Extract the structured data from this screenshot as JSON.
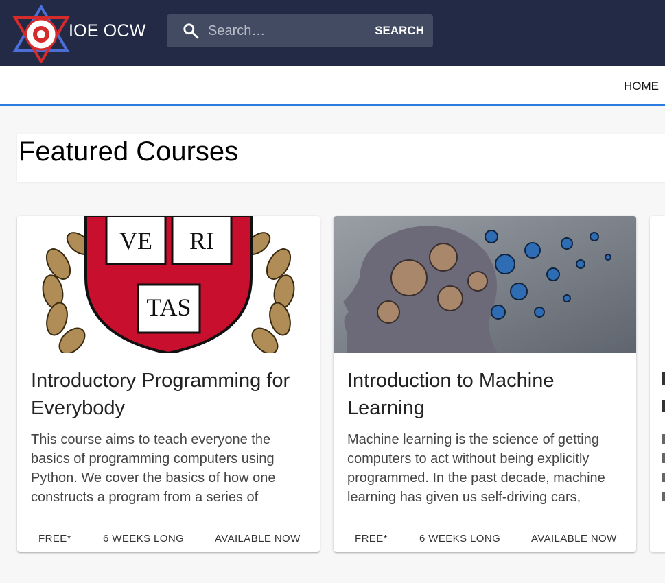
{
  "header": {
    "brand": "IOE OCW",
    "search_placeholder": "Search…",
    "search_button": "SEARCH"
  },
  "nav": {
    "home": "HOME"
  },
  "section": {
    "title": "Featured Courses"
  },
  "courses": [
    {
      "title": "Introductory Programming for Everybody",
      "description": "This course aims to teach everyone the basics of programming computers using Python. We cover the basics of how one constructs a program from a series of",
      "meta": [
        "FREE*",
        "6 WEEKS LONG",
        "AVAILABLE NOW"
      ],
      "image": "harvard-crest-veritas-image"
    },
    {
      "title": "Introduction to Machine Learning",
      "description": "Machine learning is the science of getting computers to act without being explicitly programmed. In the past decade, machine learning has given us self-driving cars,",
      "meta": [
        "FREE*",
        "6 WEEKS LONG",
        "AVAILABLE NOW"
      ],
      "image": "head-with-gears-image"
    }
  ],
  "crest": {
    "words": [
      "VE",
      "RI",
      "TAS"
    ]
  },
  "colors": {
    "header_bg": "#222a45",
    "search_bg": "#434b62",
    "nav_underline": "#2c7be0",
    "crest_red": "#c8102e",
    "laurel_gold": "#b08d57"
  }
}
